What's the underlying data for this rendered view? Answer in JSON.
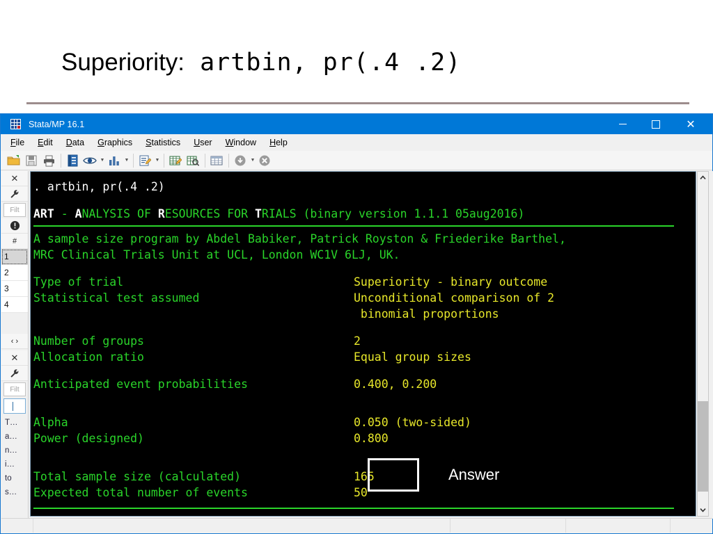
{
  "slide": {
    "title_sans": "Superiority:",
    "title_mono": " artbin, pr(.4 .2)"
  },
  "window": {
    "app_title": "Stata/MP 16.1",
    "logo_icon": "stata-grid-icon",
    "controls": {
      "minimize": "minimize-icon",
      "maximize": "maximize-icon",
      "close": "close-icon"
    }
  },
  "menubar": {
    "items": [
      {
        "pre": "",
        "key": "F",
        "post": "ile"
      },
      {
        "pre": "",
        "key": "E",
        "post": "dit"
      },
      {
        "pre": "",
        "key": "D",
        "post": "ata"
      },
      {
        "pre": "",
        "key": "G",
        "post": "raphics"
      },
      {
        "pre": "",
        "key": "S",
        "post": "tatistics"
      },
      {
        "pre": "",
        "key": "U",
        "post": "ser"
      },
      {
        "pre": "",
        "key": "W",
        "post": "indow"
      },
      {
        "pre": "",
        "key": "H",
        "post": "elp"
      }
    ]
  },
  "toolbar": {
    "buttons": [
      {
        "name": "open-file-icon",
        "glyph": "📂"
      },
      {
        "name": "save-icon",
        "glyph": "💾"
      },
      {
        "name": "print-icon",
        "glyph": "🖨"
      },
      {
        "name": "log-begin-icon",
        "glyph": "📓"
      },
      {
        "name": "viewer-eye-icon",
        "glyph": "👁"
      },
      {
        "name": "graph-bar-icon",
        "glyph": "📊"
      },
      {
        "name": "do-file-editor-icon",
        "glyph": "📝"
      },
      {
        "name": "data-editor-edit-icon",
        "glyph": "📗"
      },
      {
        "name": "data-editor-browse-icon",
        "glyph": "📘"
      },
      {
        "name": "variables-manager-icon",
        "glyph": "▤"
      },
      {
        "name": "more-icon",
        "glyph": "ⓧ"
      },
      {
        "name": "break-icon",
        "glyph": "✖"
      }
    ]
  },
  "left_dock": {
    "history_panel": {
      "close": "✕",
      "settings": "ᴰ",
      "filter_placeholder": "Filt",
      "info": "!",
      "column_header": "#",
      "rows": [
        "1",
        "2",
        "3",
        "4"
      ],
      "nav": "‹ ›"
    },
    "variables_panel": {
      "close": "✕",
      "settings": "ᴰ",
      "filter_placeholder": "Filt",
      "command_value": "",
      "entries": [
        "T…",
        "a…",
        "n…",
        "i…",
        "to",
        "s…"
      ]
    }
  },
  "console": {
    "command_line": ". artbin, pr(.4 .2)",
    "banner": {
      "prefix_a": "ART",
      "dash": " - ",
      "word1_cap": "A",
      "word1_rest": "NALYSIS ",
      "word2_pre": "OF ",
      "word2_cap": "R",
      "word2_rest": "ESOURCES ",
      "word3_pre": "FOR ",
      "word3_cap": "T",
      "word3_rest": "RIALS ",
      "version": "(binary version 1.1.1 05aug2016)"
    },
    "credits": [
      "A sample size program by Abdel Babiker, Patrick Royston & Friederike Barthel,",
      "MRC Clinical Trials Unit at UCL, London WC1V 6LJ, UK."
    ],
    "rows": [
      {
        "label": "Type of trial",
        "value": "Superiority - binary outcome"
      },
      {
        "label": "Statistical test assumed",
        "value": "Unconditional comparison of 2"
      },
      {
        "label": "",
        "value": " binomial proportions"
      },
      {
        "label": "Number of groups",
        "value": "2"
      },
      {
        "label": "Allocation ratio",
        "value": "Equal group sizes"
      },
      {
        "label": "Anticipated event probabilities",
        "value": "0.400, 0.200"
      },
      {
        "label": "Alpha",
        "value": "0.050 (two-sided)"
      },
      {
        "label": "Power (designed)",
        "value": "0.800"
      },
      {
        "label": "Total sample size (calculated)",
        "value": "165"
      },
      {
        "label": "Expected total number of events",
        "value": "50"
      }
    ],
    "scrollbar": {
      "up_arrow": "▲",
      "down_arrow": "▼"
    }
  },
  "annotation": {
    "answer_label": "Answer",
    "box_color": "#ffffff"
  },
  "colors": {
    "titlebar": "#0078d7",
    "console_bg": "#000000",
    "console_green": "#2ad52a",
    "console_yellow": "#e8e82a",
    "console_white": "#ffffff",
    "title_rule": "#9c8c8c"
  }
}
